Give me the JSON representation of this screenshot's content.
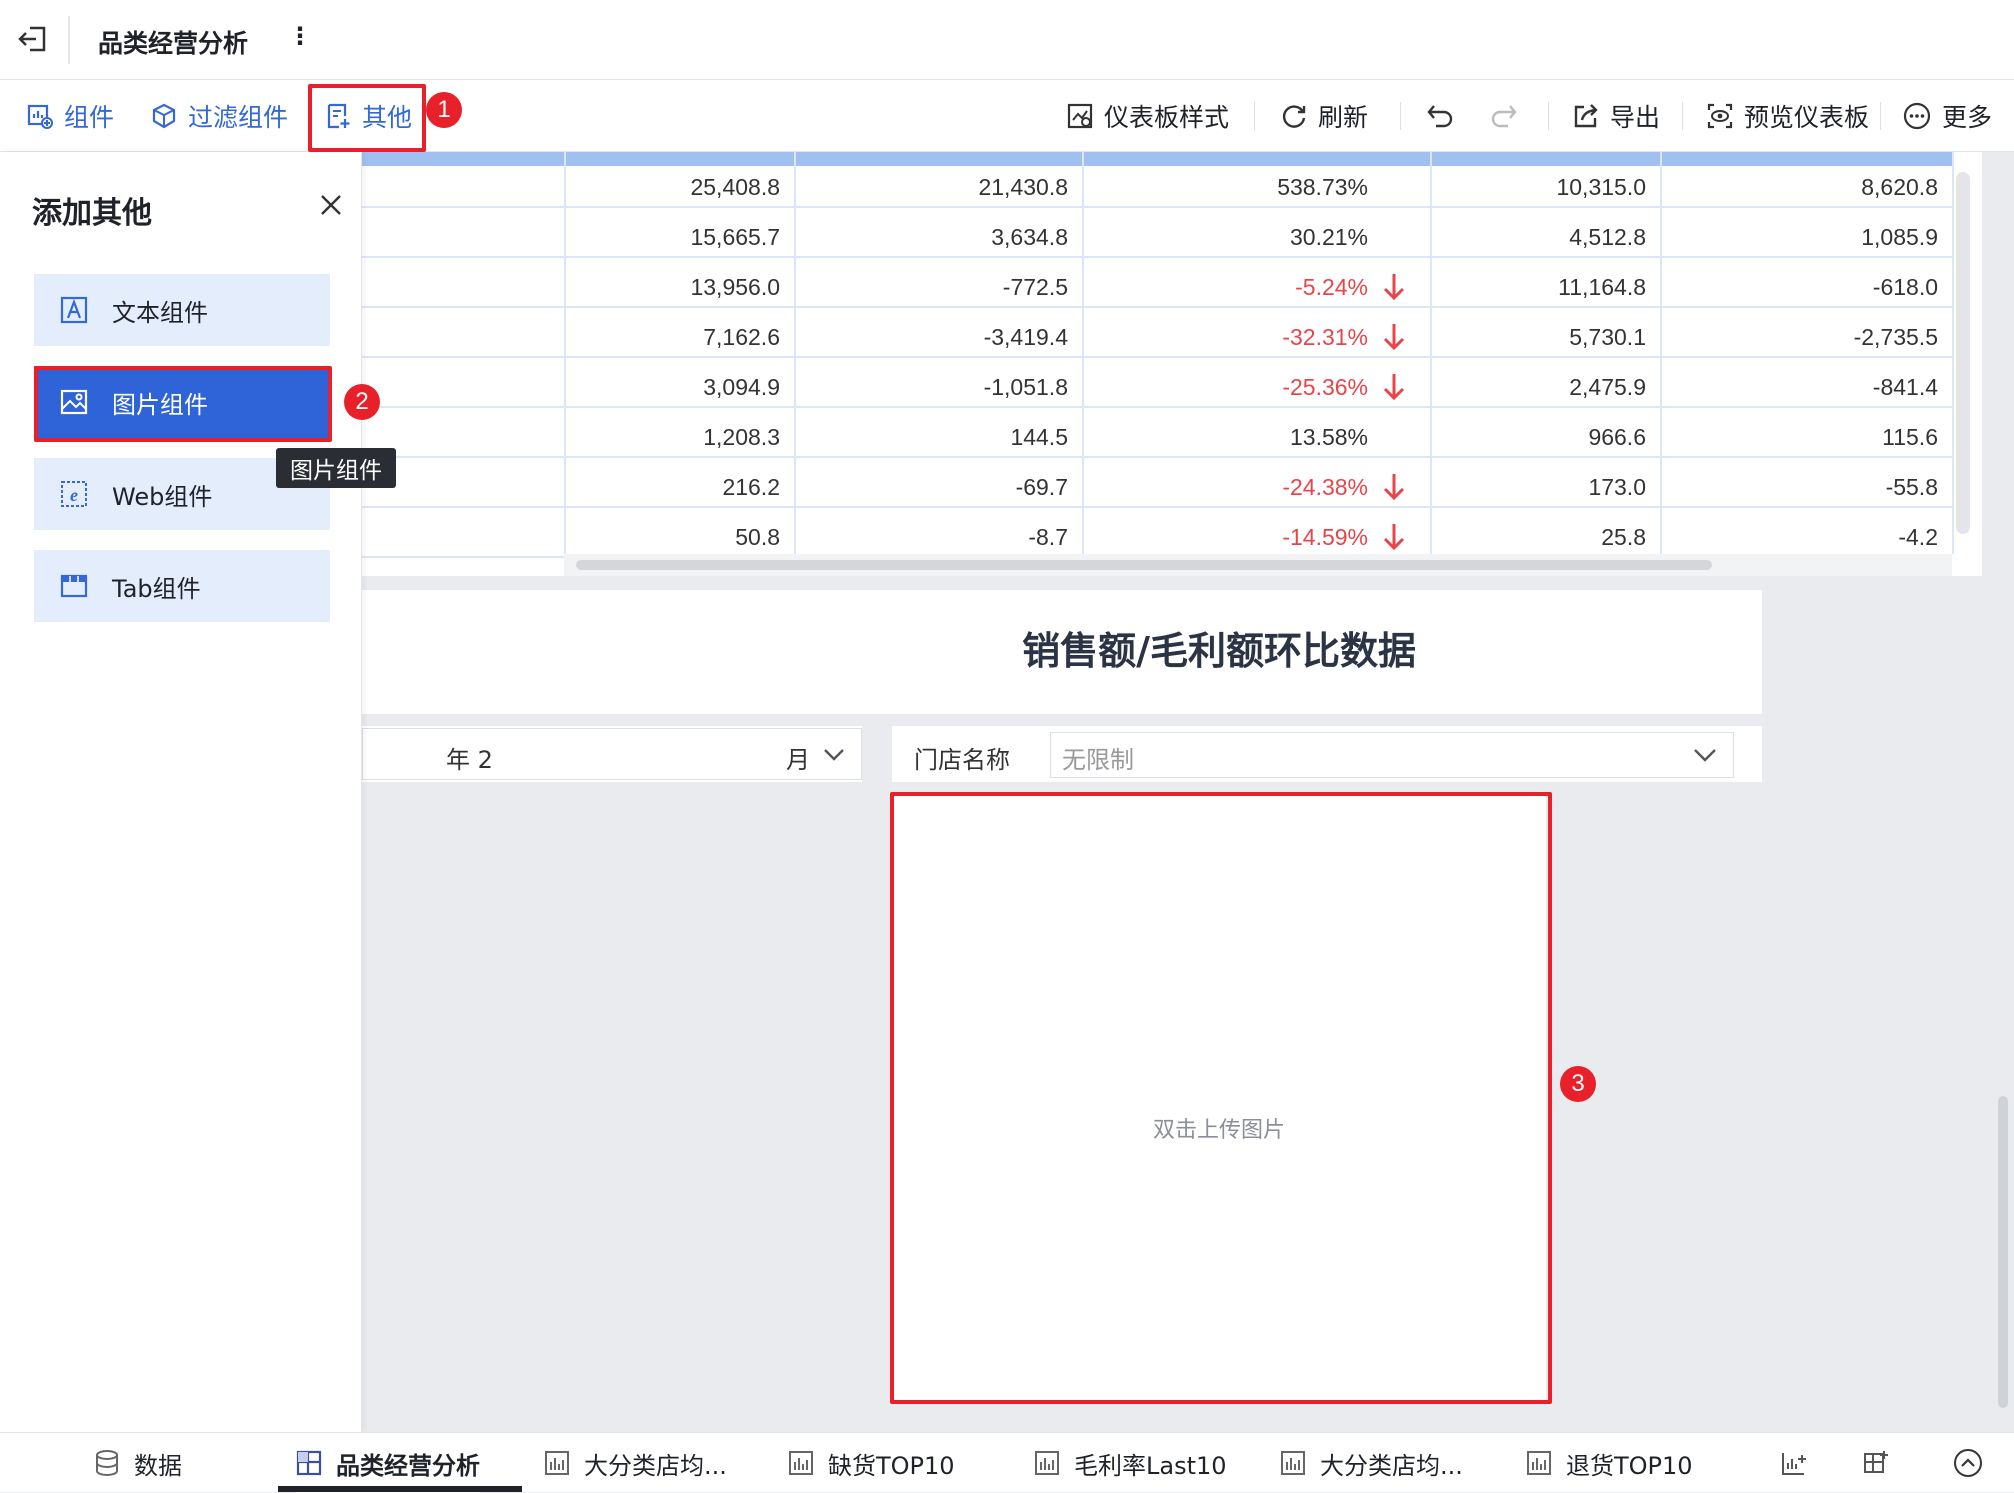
{
  "topbar": {
    "title": "品类经营分析",
    "more": "⋮"
  },
  "toolbar": {
    "left": [
      {
        "label": "组件",
        "icon": "component-icon"
      },
      {
        "label": "过滤组件",
        "icon": "filter-component-icon"
      },
      {
        "label": "其他",
        "icon": "other-icon"
      }
    ],
    "right": [
      {
        "label": "仪表板样式",
        "icon": "dashboard-style-icon"
      },
      {
        "label": "刷新",
        "icon": "refresh-icon"
      },
      {
        "label": "导出",
        "icon": "export-icon"
      },
      {
        "label": "预览仪表板",
        "icon": "preview-icon"
      },
      {
        "label": "更多",
        "icon": "more-icon"
      }
    ]
  },
  "badges": {
    "b1": "1",
    "b2": "2",
    "b3": "3"
  },
  "panel": {
    "title": "添加其他",
    "items": [
      {
        "label": "文本组件",
        "icon": "text-component-icon"
      },
      {
        "label": "图片组件",
        "icon": "image-component-icon"
      },
      {
        "label": "Web组件",
        "icon": "web-component-icon"
      },
      {
        "label": "Tab组件",
        "icon": "tab-component-icon"
      }
    ],
    "tooltip": "图片组件"
  },
  "table": {
    "rows": [
      {
        "c1": "25,408.8",
        "c2": "21,430.8",
        "c3": "538.73%",
        "c3_neg": false,
        "c4": "10,315.0",
        "c5": "8,620.8"
      },
      {
        "c1": "15,665.7",
        "c2": "3,634.8",
        "c3": "30.21%",
        "c3_neg": false,
        "c4": "4,512.8",
        "c5": "1,085.9"
      },
      {
        "c1": "13,956.0",
        "c2": "-772.5",
        "c3": "-5.24%",
        "c3_neg": true,
        "c4": "11,164.8",
        "c5": "-618.0"
      },
      {
        "c1": "7,162.6",
        "c2": "-3,419.4",
        "c3": "-32.31%",
        "c3_neg": true,
        "c4": "5,730.1",
        "c5": "-2,735.5"
      },
      {
        "c1": "3,094.9",
        "c2": "-1,051.8",
        "c3": "-25.36%",
        "c3_neg": true,
        "c4": "2,475.9",
        "c5": "-841.4"
      },
      {
        "c1": "1,208.3",
        "c2": "144.5",
        "c3": "13.58%",
        "c3_neg": false,
        "c4": "966.6",
        "c5": "115.6"
      },
      {
        "c1": "216.2",
        "c2": "-69.7",
        "c3": "-24.38%",
        "c3_neg": true,
        "c4": "173.0",
        "c5": "-55.8"
      },
      {
        "c1": "50.8",
        "c2": "-8.7",
        "c3": "-14.59%",
        "c3_neg": true,
        "c4": "25.8",
        "c5": "-4.2"
      }
    ]
  },
  "section": {
    "title": "销售额/毛利额环比数据"
  },
  "filters": {
    "year_text": "年  2",
    "month_text": "月",
    "store_label": "门店名称",
    "store_placeholder": "无限制"
  },
  "image_widget": {
    "hint": "双击上传图片"
  },
  "bottom_tabs": [
    {
      "label": "数据",
      "icon": "database-icon"
    },
    {
      "label": "品类经营分析",
      "icon": "dashboard-icon"
    },
    {
      "label": "大分类店均...",
      "icon": "chart-icon"
    },
    {
      "label": "缺货TOP10",
      "icon": "chart-icon"
    },
    {
      "label": "毛利率Last10",
      "icon": "chart-icon"
    },
    {
      "label": "大分类店均...",
      "icon": "chart-icon"
    },
    {
      "label": "退货TOP10",
      "icon": "chart-icon"
    }
  ],
  "colors": {
    "accent": "#3368d6",
    "active_item": "#2f63d8",
    "highlight": "#e8202a",
    "negative": "#e8454b"
  }
}
